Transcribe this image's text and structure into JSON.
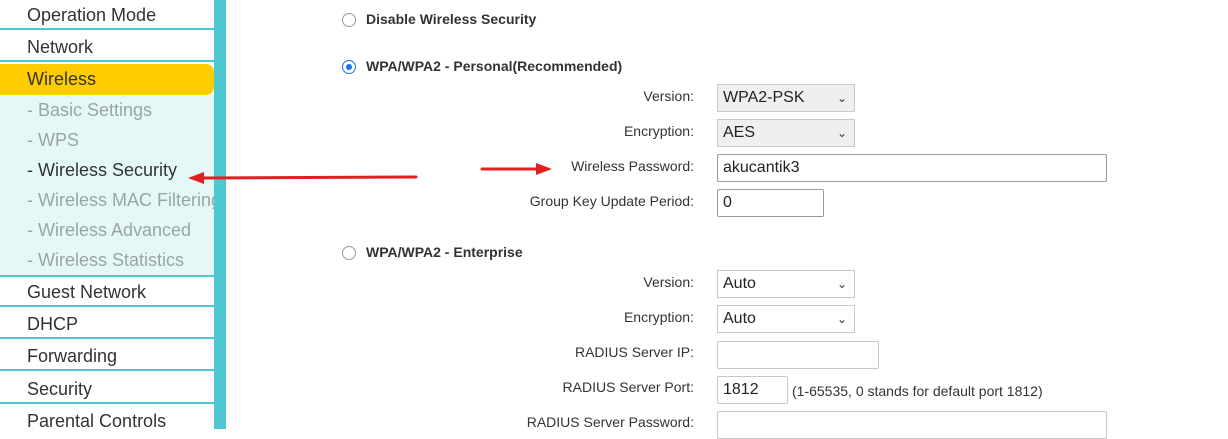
{
  "sidebar": {
    "items": [
      {
        "label": "Operation Mode"
      },
      {
        "label": "Network"
      },
      {
        "label": "Wireless"
      },
      {
        "label": "Guest Network"
      },
      {
        "label": "DHCP"
      },
      {
        "label": "Forwarding"
      },
      {
        "label": "Security"
      },
      {
        "label": "Parental Controls"
      }
    ],
    "wireless_submenu": [
      {
        "label": "- Basic Settings"
      },
      {
        "label": "- WPS"
      },
      {
        "label": "- Wireless Security"
      },
      {
        "label": "- Wireless MAC Filtering"
      },
      {
        "label": "- Wireless Advanced"
      },
      {
        "label": "- Wireless Statistics"
      }
    ],
    "active_color": "#ffcc00",
    "border_color": "#4ec8d0"
  },
  "security": {
    "disable": {
      "label": "Disable Wireless Security",
      "selected": false
    },
    "personal": {
      "label": "WPA/WPA2 - Personal(Recommended)",
      "selected": true,
      "version_label": "Version:",
      "version_value": "WPA2-PSK",
      "encryption_label": "Encryption:",
      "encryption_value": "AES",
      "password_label": "Wireless Password:",
      "password_value": "akucantik3",
      "group_key_label": "Group Key Update Period:",
      "group_key_value": "0"
    },
    "enterprise": {
      "label": "WPA/WPA2 - Enterprise",
      "selected": false,
      "version_label": "Version:",
      "version_value": "Auto",
      "encryption_label": "Encryption:",
      "encryption_value": "Auto",
      "radius_ip_label": "RADIUS Server IP:",
      "radius_ip_value": "",
      "radius_port_label": "RADIUS Server Port:",
      "radius_port_value": "1812",
      "radius_port_hint": "(1-65535, 0 stands for default port 1812)",
      "radius_password_label": "RADIUS Server Password:",
      "radius_password_value": ""
    }
  },
  "annotation_color": "#e02020"
}
